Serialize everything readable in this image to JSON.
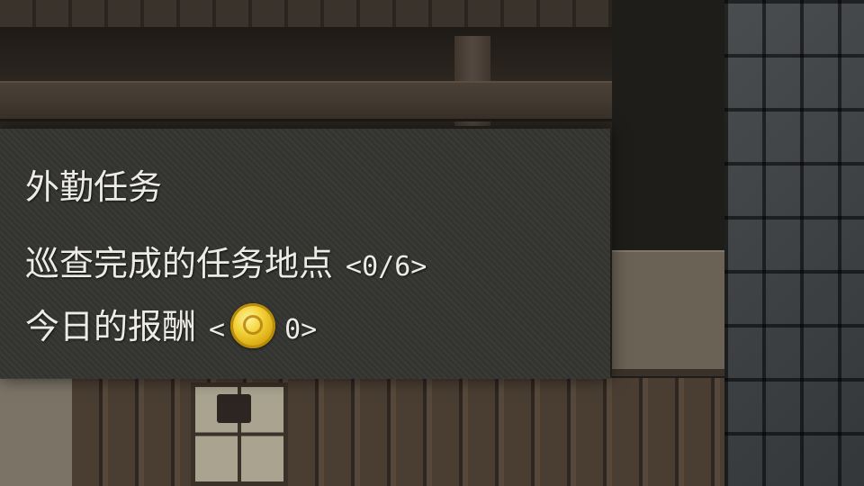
{
  "quest": {
    "title": "外勤任务",
    "objective_text": "巡查完成的任务地点",
    "objective_progress": "<0/6>",
    "reward_label": "今日的报酬",
    "reward_open": "<",
    "reward_icon": "gold-coin-icon",
    "reward_amount": "0>"
  },
  "colors": {
    "panel_background": "#343432",
    "text": "#ecebe6",
    "coin": "#f3d23a"
  }
}
